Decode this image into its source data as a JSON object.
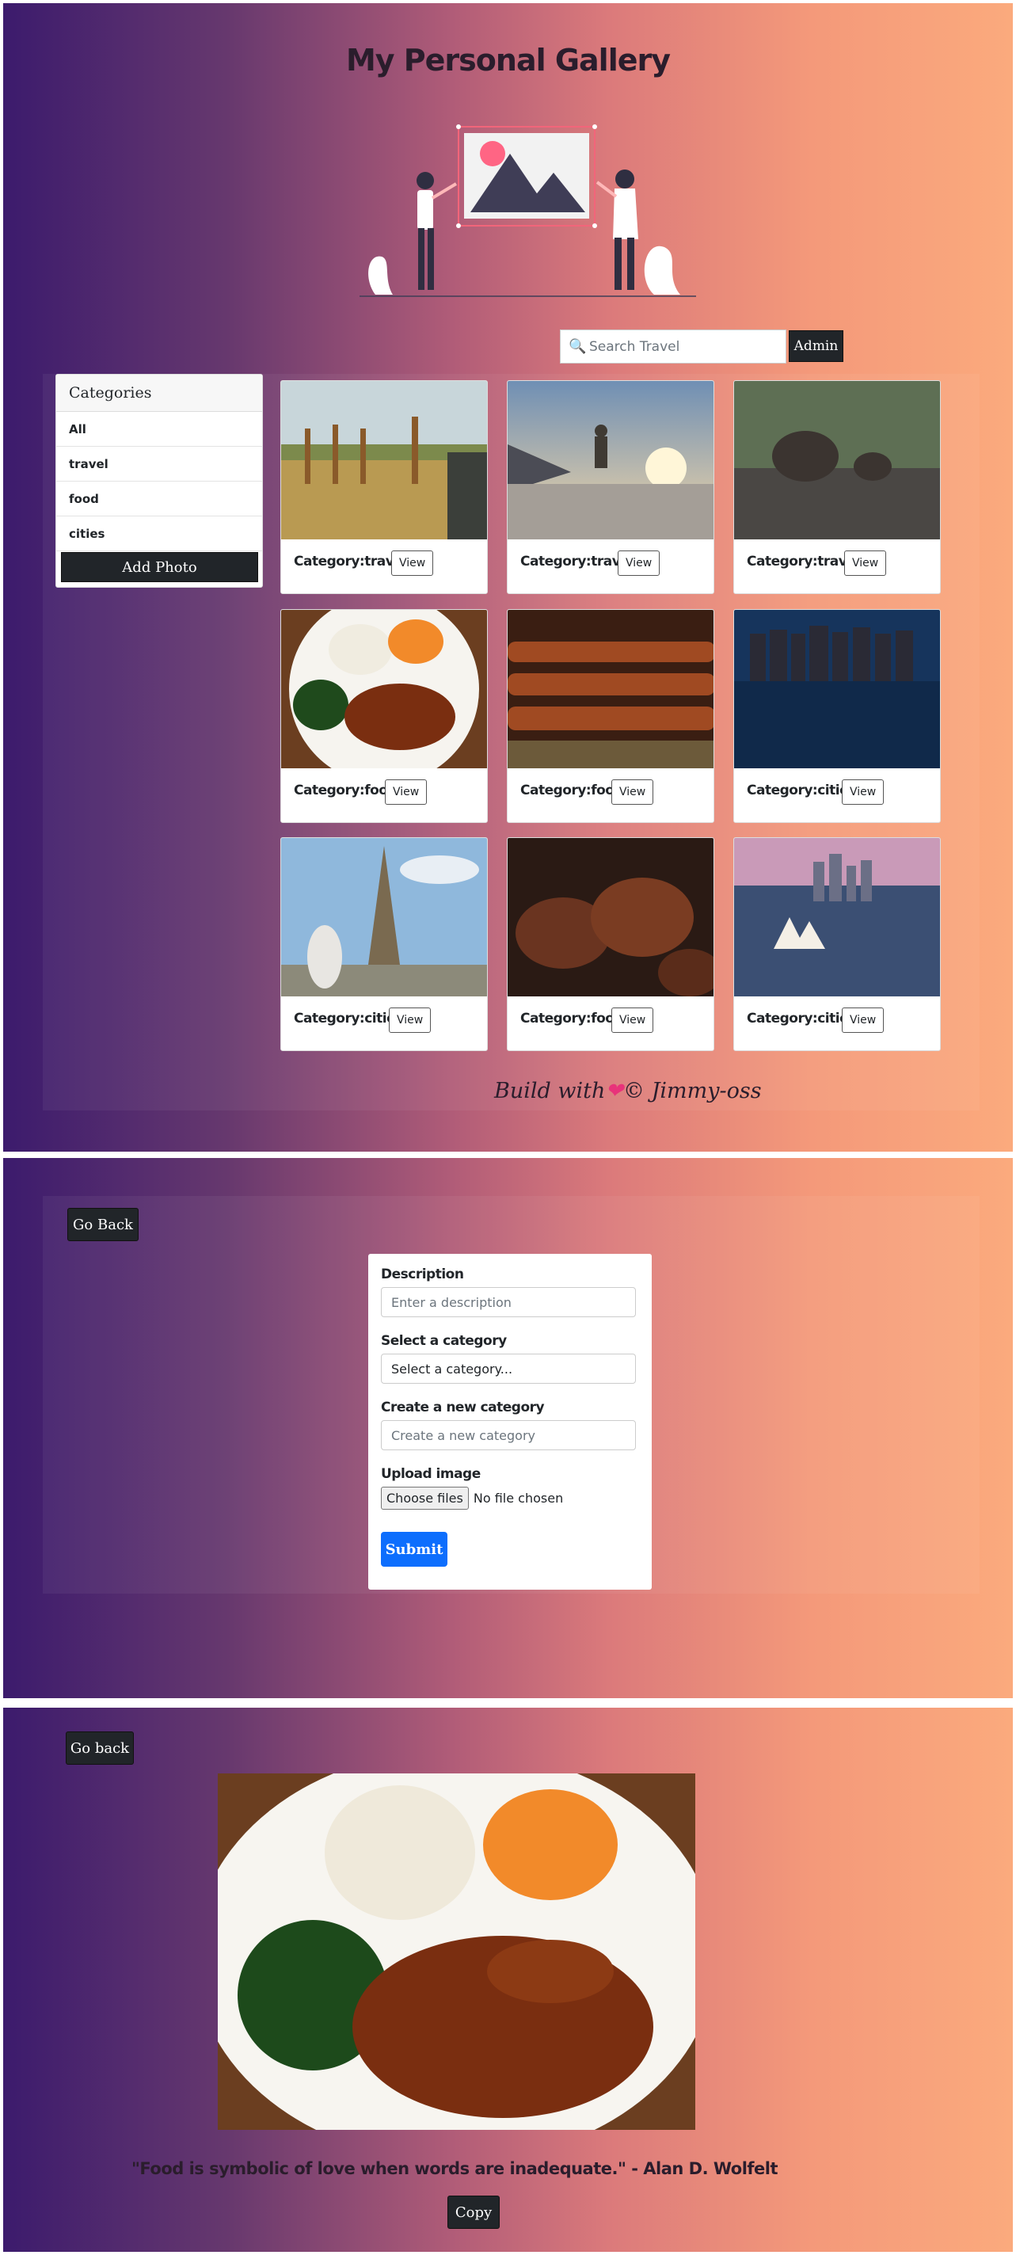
{
  "gallery": {
    "title": "My Personal Gallery",
    "search_placeholder": "Search Travel",
    "admin_label": "Admin",
    "categories_header": "Categories",
    "categories": [
      "All",
      "travel",
      "food",
      "cities"
    ],
    "add_photo_label": "Add Photo",
    "cards": [
      {
        "category": "Category:travel",
        "view": "View"
      },
      {
        "category": "Category:travel",
        "view": "View"
      },
      {
        "category": "Category:travel",
        "view": "View"
      },
      {
        "category": "Category:food",
        "view": "View"
      },
      {
        "category": "Category:food",
        "view": "View"
      },
      {
        "category": "Category:cities",
        "view": "View"
      },
      {
        "category": "Category:cities",
        "view": "View"
      },
      {
        "category": "Category:food",
        "view": "View"
      },
      {
        "category": "Category:cities",
        "view": "View"
      }
    ],
    "footer_prefix": "Build with",
    "footer_suffix": "© Jimmy-oss"
  },
  "upload": {
    "go_back_label": "Go Back",
    "description_label": "Description",
    "description_placeholder": "Enter a description",
    "category_label": "Select a category",
    "category_value": "Select a category...",
    "new_category_label": "Create a new category",
    "new_category_placeholder": "Create a new category",
    "upload_label": "Upload image",
    "choose_files_label": "Choose files",
    "no_file_text": "No file chosen",
    "submit_label": "Submit"
  },
  "detail": {
    "go_back_label": "Go back",
    "quote": "\"Food is symbolic of love when words are inadequate.\" - Alan D. Wolfelt",
    "copy_label": "Copy"
  },
  "colors": {
    "gradient_left": "#3c1b6d",
    "gradient_right": "#fbaa7d",
    "dark_button": "#212529",
    "submit_blue": "#0d6efd"
  }
}
